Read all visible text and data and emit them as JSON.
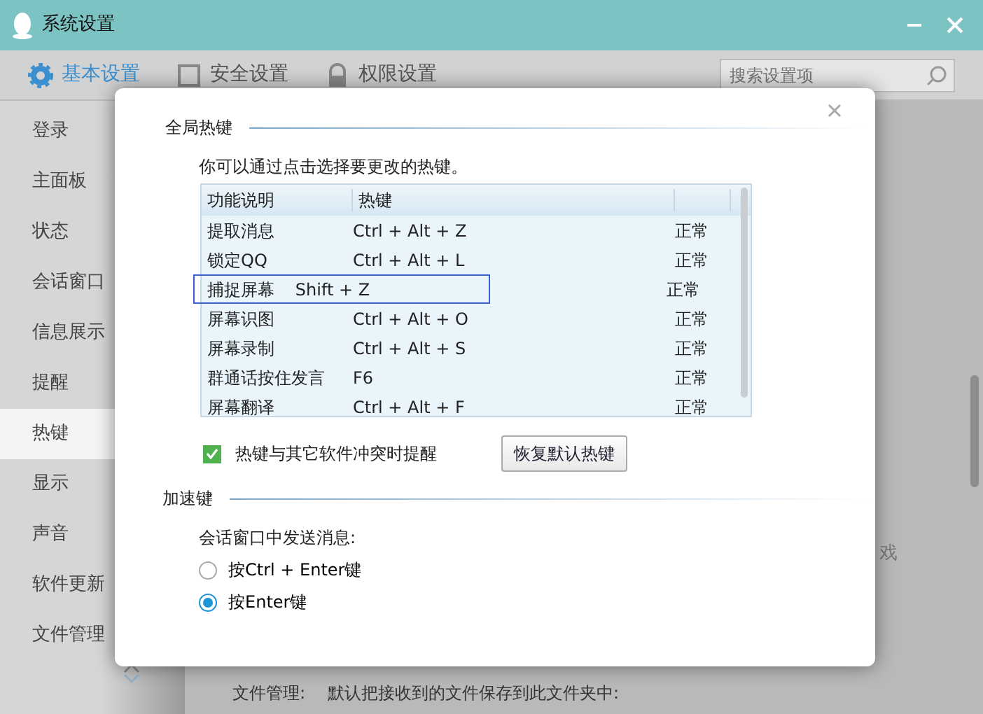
{
  "window": {
    "title": "系统设置"
  },
  "tabs": [
    {
      "label": "基本设置",
      "selected": true
    },
    {
      "label": "安全设置",
      "selected": false
    },
    {
      "label": "权限设置",
      "selected": false
    }
  ],
  "search": {
    "placeholder": "搜索设置项"
  },
  "sidebar": {
    "items": [
      {
        "label": "登录",
        "selected": false
      },
      {
        "label": "主面板",
        "selected": false
      },
      {
        "label": "状态",
        "selected": false
      },
      {
        "label": "会话窗口",
        "selected": false
      },
      {
        "label": "信息展示",
        "selected": false
      },
      {
        "label": "提醒",
        "selected": false
      },
      {
        "label": "热键",
        "selected": true
      },
      {
        "label": "显示",
        "selected": false
      },
      {
        "label": "声音",
        "selected": false
      },
      {
        "label": "软件更新",
        "selected": false
      },
      {
        "label": "文件管理",
        "selected": false
      }
    ]
  },
  "background": {
    "fragment": "戏",
    "file_label": "文件管理:",
    "file_text": "默认把接收到的文件保存到此文件夹中:"
  },
  "dialog": {
    "section_1": "全局热键",
    "description": "你可以通过点击选择要更改的热键。",
    "table": {
      "columns": [
        "功能说明",
        "热键",
        ""
      ],
      "rows": [
        {
          "name": "提取消息",
          "key": "Ctrl + Alt + Z",
          "status": "正常",
          "selected": false
        },
        {
          "name": "锁定QQ",
          "key": "Ctrl + Alt + L",
          "status": "正常",
          "selected": false
        },
        {
          "name": "捕捉屏幕",
          "key": "Shift + Z",
          "status": "正常",
          "selected": true
        },
        {
          "name": "屏幕识图",
          "key": "Ctrl + Alt + O",
          "status": "正常",
          "selected": false
        },
        {
          "name": "屏幕录制",
          "key": "Ctrl + Alt + S",
          "status": "正常",
          "selected": false
        },
        {
          "name": "群通话按住发言",
          "key": "F6",
          "status": "正常",
          "selected": false
        },
        {
          "name": "屏幕翻译",
          "key": "Ctrl + Alt + F",
          "status": "正常",
          "selected": false
        }
      ]
    },
    "conflict_checkbox": {
      "label": "热键与其它软件冲突时提醒",
      "checked": true
    },
    "restore_button": "恢复默认热键",
    "section_2": "加速键",
    "send_label": "会话窗口中发送消息:",
    "radios": [
      {
        "label": "按Ctrl + Enter键",
        "selected": false
      },
      {
        "label": "按Enter键",
        "selected": true
      }
    ]
  }
}
